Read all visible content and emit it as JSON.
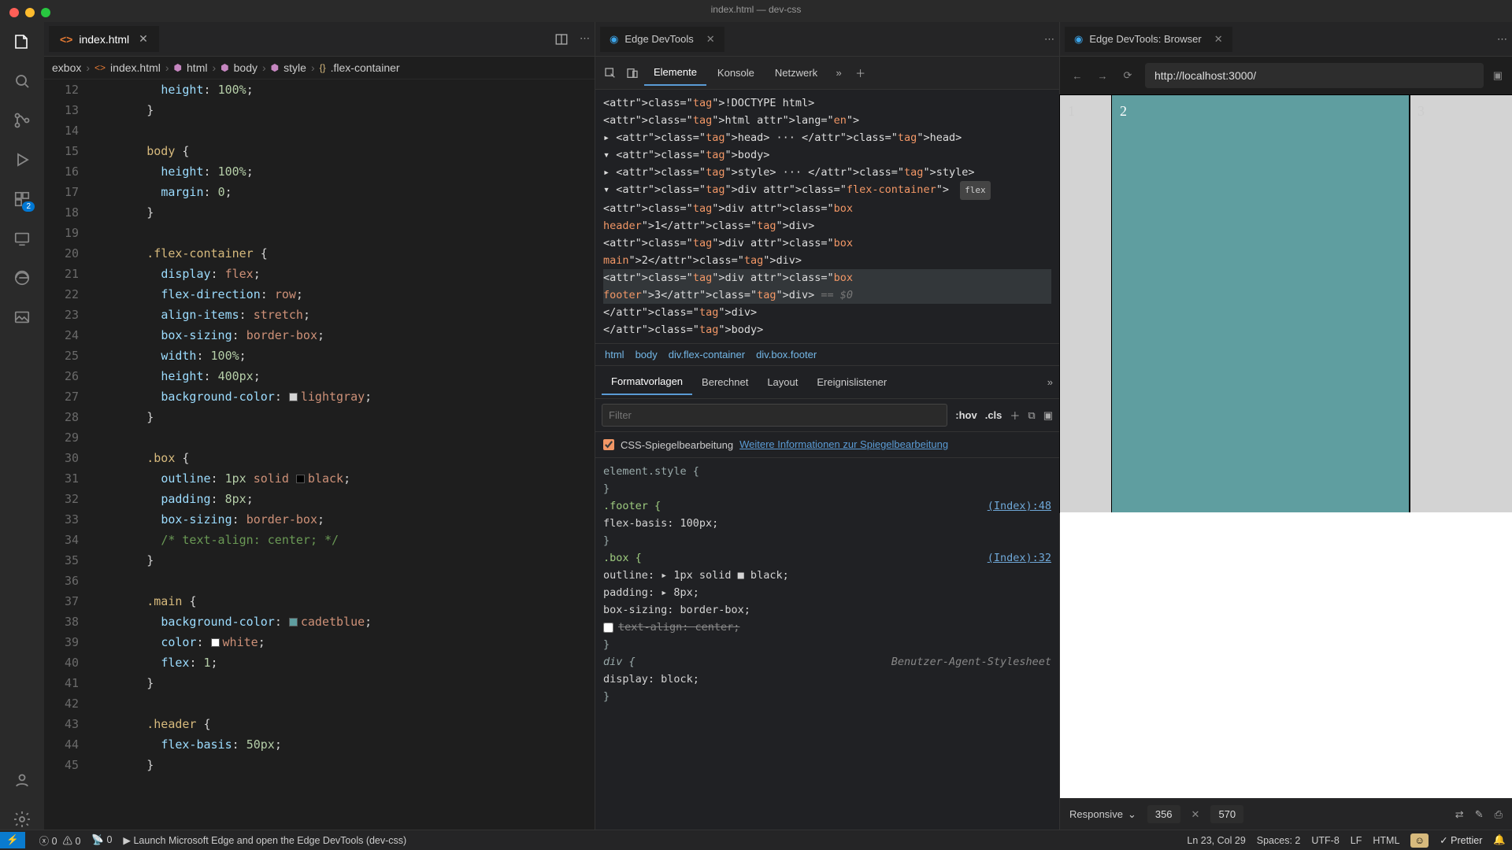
{
  "window": {
    "title": "index.html — dev-css"
  },
  "editor": {
    "tab": {
      "label": "index.html",
      "icon": "<>"
    },
    "breadcrumb": [
      "exbox",
      "index.html",
      "html",
      "body",
      "style",
      ".flex-container"
    ],
    "lines": [
      {
        "n": 12,
        "html": "          <span class='prop'>height</span><span class='punc'>:</span> <span class='num'>100%</span><span class='punc'>;</span>"
      },
      {
        "n": 13,
        "html": "        <span class='punc'>}</span>"
      },
      {
        "n": 14,
        "html": ""
      },
      {
        "n": 15,
        "html": "        <span class='sel'>body</span> <span class='punc'>{</span>"
      },
      {
        "n": 16,
        "html": "          <span class='prop'>height</span><span class='punc'>:</span> <span class='num'>100%</span><span class='punc'>;</span>"
      },
      {
        "n": 17,
        "html": "          <span class='prop'>margin</span><span class='punc'>:</span> <span class='num'>0</span><span class='punc'>;</span>"
      },
      {
        "n": 18,
        "html": "        <span class='punc'>}</span>"
      },
      {
        "n": 19,
        "html": ""
      },
      {
        "n": 20,
        "html": "        <span class='sel'>.flex-container</span> <span class='punc'>{</span>"
      },
      {
        "n": 21,
        "html": "          <span class='prop'>display</span><span class='punc'>:</span> <span class='val'>flex</span><span class='punc'>;</span>"
      },
      {
        "n": 22,
        "html": "          <span class='prop'>flex-direction</span><span class='punc'>:</span> <span class='val'>row</span><span class='punc'>;</span>"
      },
      {
        "n": 23,
        "html": "          <span class='prop'>align-items</span><span class='punc'>:</span> <span class='val'>stretch</span><span class='punc'>;</span>"
      },
      {
        "n": 24,
        "html": "          <span class='prop'>box-sizing</span><span class='punc'>:</span> <span class='val'>border-box</span><span class='punc'>;</span>"
      },
      {
        "n": 25,
        "html": "          <span class='prop'>width</span><span class='punc'>:</span> <span class='num'>100%</span><span class='punc'>;</span>"
      },
      {
        "n": 26,
        "html": "          <span class='prop'>height</span><span class='punc'>:</span> <span class='num'>400px</span><span class='punc'>;</span>"
      },
      {
        "n": 27,
        "html": "          <span class='prop'>background-color</span><span class='punc'>:</span> <span class='swatch' style='background:lightgray'></span><span class='val'>lightgray</span><span class='punc'>;</span>"
      },
      {
        "n": 28,
        "html": "        <span class='punc'>}</span>"
      },
      {
        "n": 29,
        "html": ""
      },
      {
        "n": 30,
        "html": "        <span class='sel'>.box</span> <span class='punc'>{</span>"
      },
      {
        "n": 31,
        "html": "          <span class='prop'>outline</span><span class='punc'>:</span> <span class='num'>1px</span> <span class='val'>solid</span> <span class='swatch' style='background:black'></span><span class='val'>black</span><span class='punc'>;</span>"
      },
      {
        "n": 32,
        "html": "          <span class='prop'>padding</span><span class='punc'>:</span> <span class='num'>8px</span><span class='punc'>;</span>"
      },
      {
        "n": 33,
        "html": "          <span class='prop'>box-sizing</span><span class='punc'>:</span> <span class='val'>border-box</span><span class='punc'>;</span>"
      },
      {
        "n": 34,
        "html": "          <span class='com'>/* text-align: center; */</span>"
      },
      {
        "n": 35,
        "html": "        <span class='punc'>}</span>"
      },
      {
        "n": 36,
        "html": ""
      },
      {
        "n": 37,
        "html": "        <span class='sel'>.main</span> <span class='punc'>{</span>"
      },
      {
        "n": 38,
        "html": "          <span class='prop'>background-color</span><span class='punc'>:</span> <span class='swatch' style='background:cadetblue'></span><span class='val'>cadetblue</span><span class='punc'>;</span>"
      },
      {
        "n": 39,
        "html": "          <span class='prop'>color</span><span class='punc'>:</span> <span class='swatch' style='background:white'></span><span class='val'>white</span><span class='punc'>;</span>"
      },
      {
        "n": 40,
        "html": "          <span class='prop'>flex</span><span class='punc'>:</span> <span class='num'>1</span><span class='punc'>;</span>"
      },
      {
        "n": 41,
        "html": "        <span class='punc'>}</span>"
      },
      {
        "n": 42,
        "html": ""
      },
      {
        "n": 43,
        "html": "        <span class='sel'>.header</span> <span class='punc'>{</span>"
      },
      {
        "n": 44,
        "html": "          <span class='prop'>flex-basis</span><span class='punc'>:</span> <span class='num'>50px</span><span class='punc'>;</span>"
      },
      {
        "n": 45,
        "html": "        <span class='punc'>}</span>"
      }
    ]
  },
  "devtools": {
    "tab_label": "Edge DevTools",
    "tabs": [
      "Elemente",
      "Konsole",
      "Netzwerk"
    ],
    "dom": [
      "<!DOCTYPE html>",
      "<html lang=\"en\">",
      "  ▸ <head> ··· </head>",
      "  ▾ <body>",
      "    ▸ <style> ··· </style>",
      "    ▾ <div class=\"flex-container\">  [flex]",
      "        <div class=\"box header\">1</div>",
      "        <div class=\"box main\">2</div>",
      "        <div class=\"box footer\">3</div>   == $0",
      "      </div>",
      "    </body>"
    ],
    "dom_breadcrumb": [
      "html",
      "body",
      "div.flex-container",
      "div.box.footer"
    ],
    "styles_tabs": [
      "Formatvorlagen",
      "Berechnet",
      "Layout",
      "Ereignislistener"
    ],
    "filter_placeholder": "Filter",
    "hov": ":hov",
    "cls": ".cls",
    "mirror_label": "CSS-Spiegelbearbeitung",
    "mirror_link": "Weitere Informationen zur Spiegelbearbeitung",
    "rules": {
      "element_style": "element.style {",
      "footer_sel": ".footer {",
      "footer_src": "(Index):48",
      "footer_body": "  flex-basis: 100px;",
      "box_sel": ".box {",
      "box_src": "(Index):32",
      "box_l1": "  outline: ▸ 1px solid ■ black;",
      "box_l2": "  padding: ▸ 8px;",
      "box_l3": "  box-sizing: border-box;",
      "box_l4_strike": "  text-align: center;",
      "div_sel": "div {",
      "ua_label": "Benutzer-Agent-Stylesheet",
      "div_body": "  display: block;"
    }
  },
  "preview": {
    "tab_label": "Edge DevTools: Browser",
    "url": "http://localhost:3000/",
    "boxes": [
      "1",
      "2",
      "3"
    ],
    "responsive_label": "Responsive",
    "width": "356",
    "height": "570"
  },
  "statusbar": {
    "errors": "0",
    "warnings": "0",
    "ports": "0",
    "launch": "Launch Microsoft Edge and open the Edge DevTools (dev-css)",
    "lncol": "Ln 23, Col 29",
    "spaces": "Spaces: 2",
    "encoding": "UTF-8",
    "eol": "LF",
    "lang": "HTML",
    "prettier": "Prettier"
  },
  "activity_badge": "2"
}
